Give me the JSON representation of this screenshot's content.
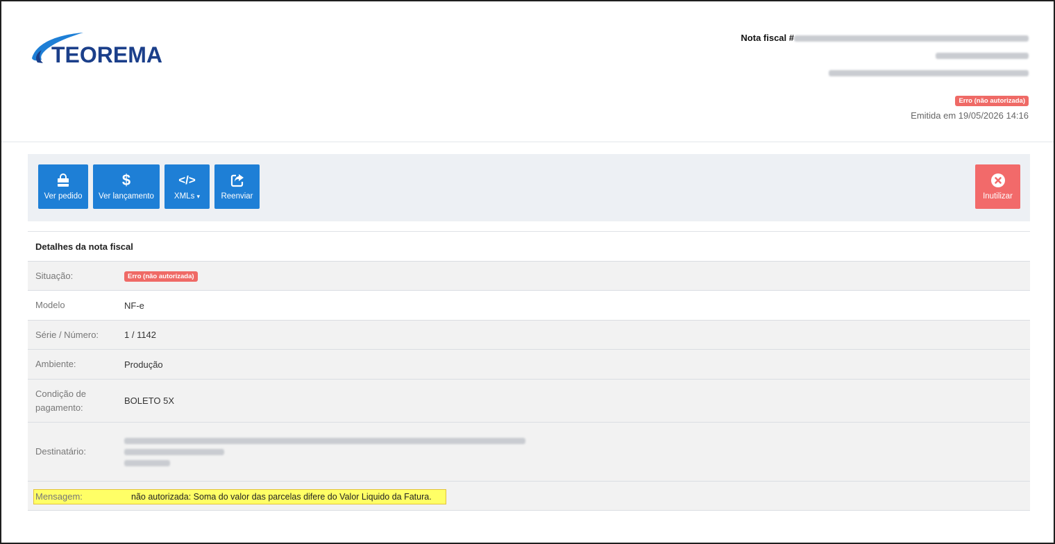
{
  "brand": {
    "logo_text": "TEOREMA",
    "logo_color": "#1b3f8a",
    "swoosh_color": "#1e7fd6"
  },
  "nota": {
    "title_prefix": "Nota fiscal #",
    "status_badge": "Erro (não autorizada)",
    "emitted": "Emitida em 19/05/2026 14:16"
  },
  "toolbar": {
    "buttons": [
      {
        "label": "Ver pedido",
        "icon": "shopping-bag-icon"
      },
      {
        "label": "Ver lançamento",
        "icon": "dollar-icon"
      },
      {
        "label": "XMLs",
        "icon": "code-icon",
        "caret": "▾"
      },
      {
        "label": "Reenviar",
        "icon": "share-icon"
      }
    ],
    "danger_button": {
      "label": "Inutilizar",
      "icon": "close-circle-icon"
    }
  },
  "details": {
    "heading": "Detalhes da nota fiscal",
    "rows": [
      {
        "label": "Situação:",
        "value": "Erro (não autorizada)"
      },
      {
        "label": "Modelo",
        "value": "NF-e"
      },
      {
        "label": "Série / Número:",
        "value": "1 / 1142"
      },
      {
        "label": "Ambiente:",
        "value": "Produção"
      },
      {
        "label": "Condição de pagamento:",
        "value": "BOLETO 5X"
      },
      {
        "label": "Destinatário:",
        "value": ""
      },
      {
        "label": "Mensagem:",
        "value": "não autorizada: Soma do valor das parcelas difere do Valor Liquido da Fatura."
      }
    ]
  },
  "colors": {
    "primary": "#1e7fd6",
    "danger": "#f26a6a",
    "badge": "#ef6a66",
    "highlight": "#ffff66"
  }
}
